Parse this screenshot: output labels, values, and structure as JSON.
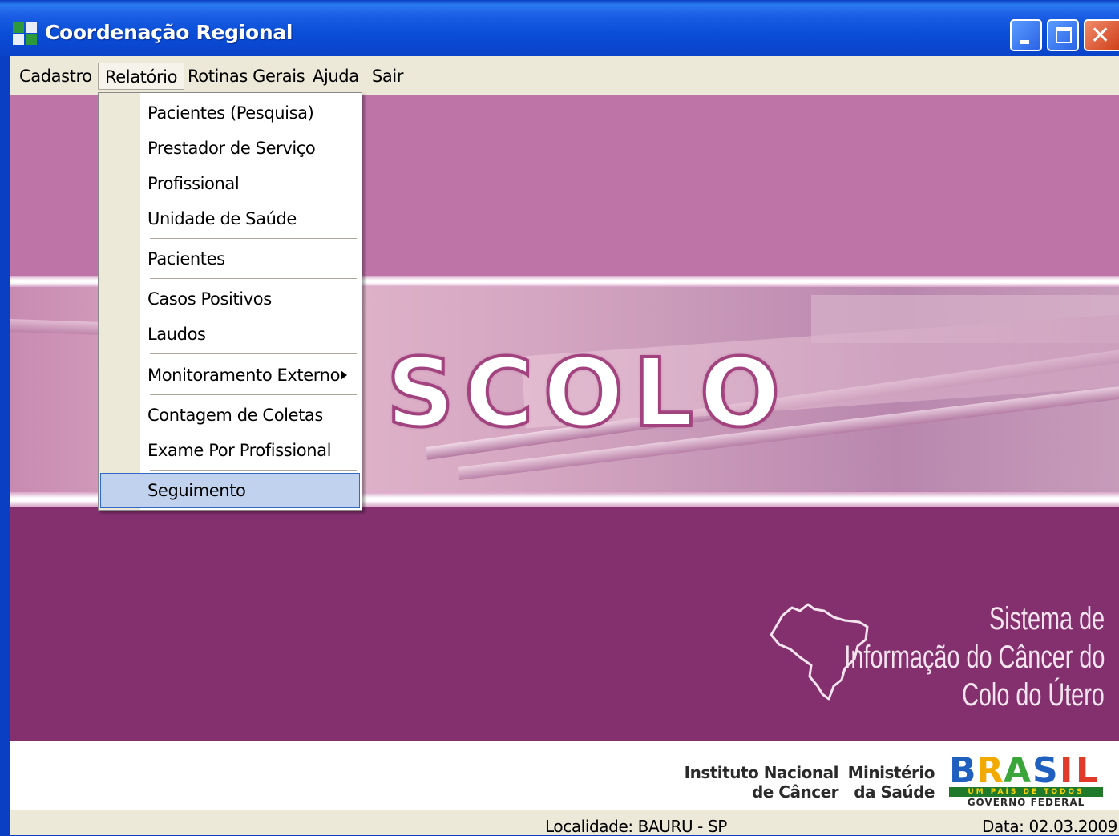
{
  "window": {
    "title": "Coordenação Regional"
  },
  "menubar": {
    "items": [
      "Cadastro",
      "Relatório",
      "Rotinas Gerais",
      "Ajuda",
      "Sair"
    ],
    "open_menu": "Relatório"
  },
  "dropdown": {
    "items": [
      "Pacientes (Pesquisa)",
      "Prestador de Serviço",
      "Profissional",
      "Unidade de Saúde",
      "Pacientes",
      "Casos Positivos",
      "Laudos",
      "Monitoramento Externo",
      "Contagem de Coletas",
      "Exame Por Profissional",
      "Seguimento"
    ],
    "highlighted": "Seguimento",
    "submenu_item": "Monitoramento Externo"
  },
  "banner": {
    "logo_word": "SCOLO",
    "system_name_line1": "Sistema de",
    "system_name_line2": "Informação do Câncer do",
    "system_name_line3": "Colo do Útero"
  },
  "footer": {
    "inca_line1": "Instituto Nacional",
    "inca_line2": "de Câncer",
    "ms_line1": "Ministério",
    "ms_line2": "da Saúde",
    "brasil_word": "BRASIL",
    "brasil_tagline": "UM PAÍS DE TODOS",
    "brasil_gov": "GOVERNO FEDERAL"
  },
  "statusbar": {
    "locality": "Localidade: BAURU - SP",
    "date": "Data: 02.03.2009"
  },
  "colors": {
    "titlebar_blue": "#0a4fd8",
    "menu_bg": "#ece9d8",
    "band_top": "#bf74a8",
    "band_bottom": "#84306f",
    "highlight": "#c1d2ee"
  }
}
